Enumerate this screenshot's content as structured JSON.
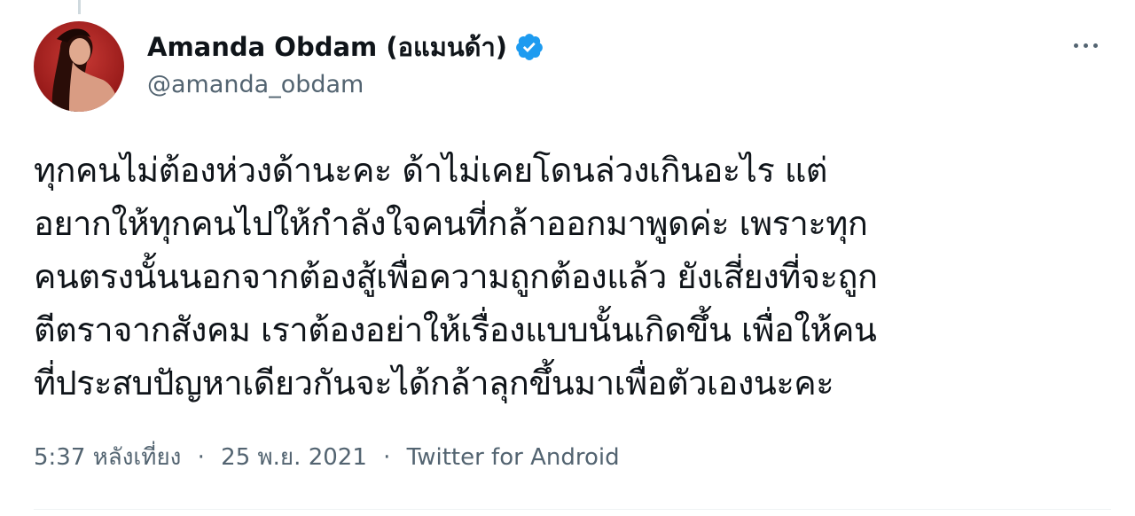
{
  "tweet": {
    "author": {
      "display_name": "Amanda Obdam (อแมนด้า)",
      "handle": "@amanda_obdam",
      "verified": true
    },
    "text": "ทุกคนไม่ต้องห่วงด้านะคะ ด้าไม่เคยโดนล่วงเกินอะไร แต่\nอยากให้ทุกคนไปให้กำลังใจคนที่กล้าออกมาพูดค่ะ เพราะทุก\nคนตรงนั้นนอกจากต้องสู้เพื่อความถูกต้องแล้ว ยังเสี่ยงที่จะถูก\nตีตราจากสังคม เราต้องอย่าให้เรื่องแบบนั้นเกิดขึ้น เพื่อให้คน\nที่ประสบปัญหาเดียวกันจะได้กล้าลุกขึ้นมาเพื่อตัวเองนะคะ",
    "meta": {
      "time": "5:37 หลังเที่ยง",
      "date": "25 พ.ย. 2021",
      "source": "Twitter for Android",
      "separator": "·"
    }
  },
  "colors": {
    "text_primary": "#0f1419",
    "text_secondary": "#536471",
    "verified_blue": "#1d9bf0",
    "avatar_background": "#b0201f"
  },
  "icons": {
    "verified": "verified-badge-icon",
    "more": "more-horizontal-icon"
  }
}
